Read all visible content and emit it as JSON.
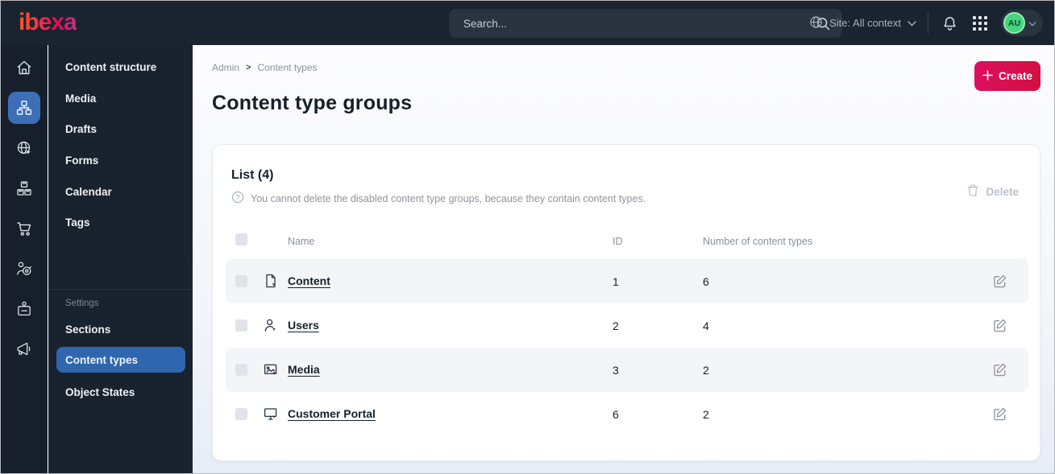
{
  "topbar": {
    "logo_text": "ibexa",
    "search_placeholder": "Search...",
    "site_context_label": "Site: All context",
    "avatar_initials": "AU"
  },
  "sidebar": {
    "rail_icons": [
      "home-icon",
      "content-tree-icon",
      "site-globe-icon",
      "products-icon",
      "cart-icon",
      "personalization-icon",
      "badge-icon",
      "megaphone-icon"
    ],
    "items": [
      {
        "label": "Content structure"
      },
      {
        "label": "Media"
      },
      {
        "label": "Drafts"
      },
      {
        "label": "Forms"
      },
      {
        "label": "Calendar"
      },
      {
        "label": "Tags"
      }
    ],
    "settings_heading": "Settings",
    "settings_items": [
      {
        "label": "Sections",
        "active": false
      },
      {
        "label": "Content types",
        "active": true
      },
      {
        "label": "Object States",
        "active": false
      }
    ]
  },
  "main": {
    "breadcrumb": {
      "items": [
        "Admin",
        "Content types"
      ],
      "separator": ">"
    },
    "page_title": "Content type groups",
    "create_button_label": "Create",
    "list": {
      "title": "List (4)",
      "help_text": "You cannot delete the disabled content type groups, because they contain content types.",
      "delete_button_label": "Delete",
      "columns": {
        "name": "Name",
        "id": "ID",
        "count": "Number of content types"
      },
      "rows": [
        {
          "icon": "content-file-icon",
          "name": "Content",
          "id": "1",
          "count": "6"
        },
        {
          "icon": "user-icon",
          "name": "Users",
          "id": "2",
          "count": "4"
        },
        {
          "icon": "media-image-icon",
          "name": "Media",
          "id": "3",
          "count": "2"
        },
        {
          "icon": "customer-portal-screen-icon",
          "name": "Customer Portal",
          "id": "6",
          "count": "2"
        }
      ]
    }
  },
  "colors": {
    "topbar_bg": "#1a2330",
    "sidebar_bg": "#161f2b",
    "active_blue": "#3c6fb6",
    "brand_gradient_start": "#ff5a1f",
    "brand_gradient_end": "#b93a8c",
    "create_gradient_start": "#dc0f62",
    "create_gradient_end": "#d30f3f",
    "avatar_green": "#49d17e",
    "row_alt_bg": "#f4f5f8"
  }
}
